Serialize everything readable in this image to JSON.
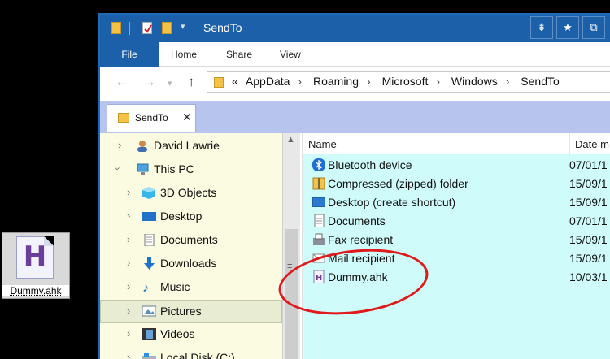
{
  "desktop": {
    "icon_label": "Dummy.ahk",
    "icon_letter": "H"
  },
  "window": {
    "title": "SendTo"
  },
  "ribbon": {
    "tabs": [
      "File",
      "Home",
      "Share",
      "View"
    ]
  },
  "address": {
    "prefix": "«",
    "crumbs": [
      "AppData",
      "Roaming",
      "Microsoft",
      "Windows",
      "SendTo"
    ],
    "sep": "›"
  },
  "doc_tab": {
    "label": "SendTo",
    "close": "✕"
  },
  "nav_pane": {
    "items": [
      {
        "label": "David Lawrie",
        "icon": "user-icon"
      },
      {
        "label": "This PC",
        "icon": "computer-icon"
      },
      {
        "label": "3D Objects",
        "icon": "cube-icon"
      },
      {
        "label": "Desktop",
        "icon": "desktop-icon"
      },
      {
        "label": "Documents",
        "icon": "documents-icon"
      },
      {
        "label": "Downloads",
        "icon": "download-icon"
      },
      {
        "label": "Music",
        "icon": "music-icon"
      },
      {
        "label": "Pictures",
        "icon": "pictures-icon"
      },
      {
        "label": "Videos",
        "icon": "video-icon"
      },
      {
        "label": "Local Disk (C:)",
        "icon": "disk-icon"
      }
    ]
  },
  "file_list": {
    "columns": {
      "name": "Name",
      "date": "Date m"
    },
    "rows": [
      {
        "name": "Bluetooth device",
        "date": "07/01/1",
        "icon": "bluetooth-icon"
      },
      {
        "name": "Compressed (zipped) folder",
        "date": "15/09/1",
        "icon": "zip-icon"
      },
      {
        "name": "Desktop (create shortcut)",
        "date": "15/09/1",
        "icon": "desktop-shortcut-icon"
      },
      {
        "name": "Documents",
        "date": "07/01/1",
        "icon": "documents-icon"
      },
      {
        "name": "Fax recipient",
        "date": "15/09/1",
        "icon": "fax-icon"
      },
      {
        "name": "Mail recipient",
        "date": "15/09/1",
        "icon": "mail-icon"
      },
      {
        "name": "Dummy.ahk",
        "date": "10/03/1",
        "icon": "ahk-file-icon"
      }
    ]
  },
  "colors": {
    "titlebar": "#1c60a9",
    "nav_bg": "#fafbe0",
    "content_bg": "#cffcfb",
    "tab_strip": "#b7c5ee",
    "highlight_ring": "#e0191c"
  }
}
